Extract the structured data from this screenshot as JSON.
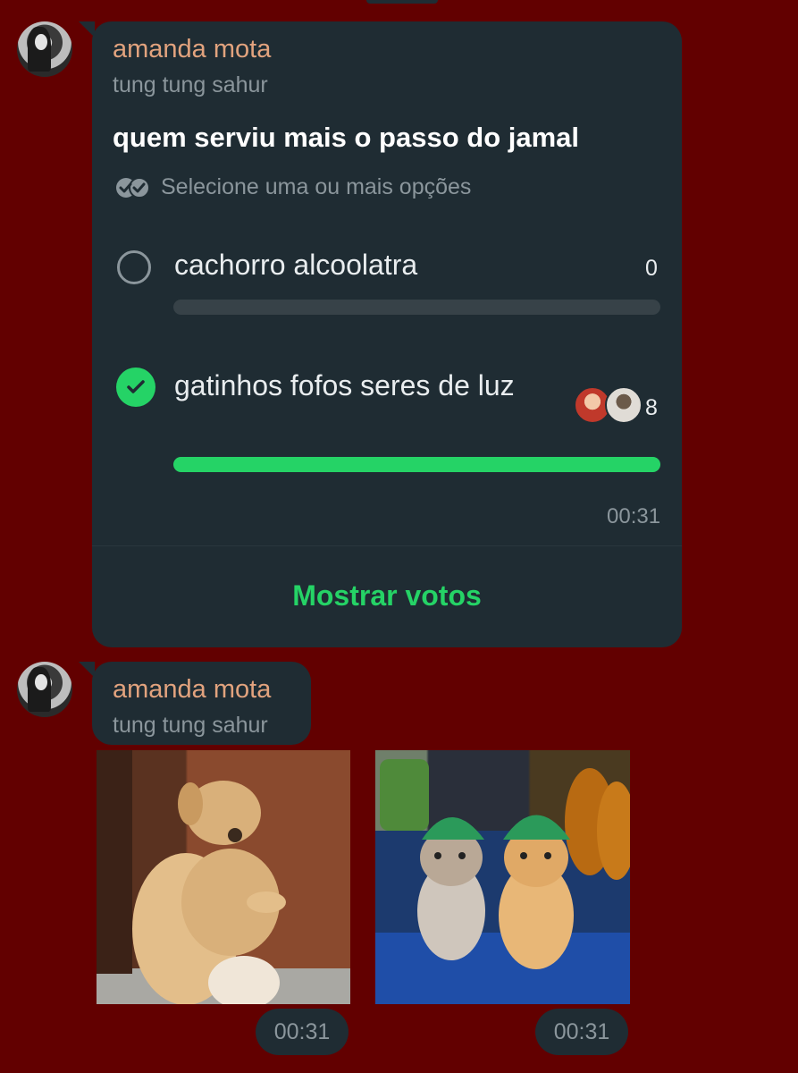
{
  "poll_message": {
    "sender": "amanda mota",
    "subtitle": "tung tung sahur",
    "question": "quem serviu mais o passo do jamal",
    "hint": "Selecione uma ou mais opções",
    "options": [
      {
        "label": "cachorro alcoolatra",
        "count": "0",
        "fraction": 0,
        "selected": false
      },
      {
        "label": "gatinhos fofos seres de luz",
        "count": "8",
        "fraction": 1,
        "selected": true
      }
    ],
    "time": "00:31",
    "show_votes_label": "Mostrar votos",
    "accent_color": "#25d366"
  },
  "media_message": {
    "sender": "amanda mota",
    "subtitle": "tung tung sahur",
    "items": [
      {
        "subject": "dancing-dog-gif",
        "time": "00:31"
      },
      {
        "subject": "cats-with-hats-gif",
        "time": "00:31"
      }
    ]
  },
  "colors": {
    "chat_background": "#620000",
    "bubble": "#1f2c33",
    "sender_name": "#e2a37e"
  }
}
